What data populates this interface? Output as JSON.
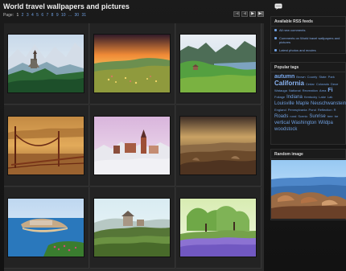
{
  "header": {
    "title": "World travel wallpapers and pictures"
  },
  "pager": {
    "label": "Page:",
    "pages": [
      "1",
      "2",
      "3",
      "4",
      "5",
      "6",
      "7",
      "8",
      "9",
      "10",
      "...",
      "30",
      "31"
    ]
  },
  "sidebar": {
    "rss_title": "Available RSS feeds",
    "rss_items": [
      "All new comments",
      "Comments on World travel wallpapers and pictures",
      "Latest photos and movies"
    ],
    "tags_title": "Popular tags",
    "tags_lines": [
      [
        {
          "text": "autumn",
          "size": "lg"
        },
        {
          "text": "Brown",
          "size": "sm"
        },
        {
          "text": "County",
          "size": "sm"
        },
        {
          "text": "State",
          "size": "sm"
        },
        {
          "text": "Park",
          "size": "sm"
        }
      ],
      [
        {
          "text": "California",
          "size": "xl"
        },
        {
          "text": "Cedar",
          "size": "sm"
        },
        {
          "text": "Colorado",
          "size": "sm"
        },
        {
          "text": "Dece",
          "size": "sm"
        }
      ],
      [
        {
          "text": "Watauga",
          "size": "sm"
        },
        {
          "text": "National",
          "size": "sm"
        },
        {
          "text": "Recreation",
          "size": "sm"
        },
        {
          "text": "Area",
          "size": "sm"
        },
        {
          "text": "Fi",
          "size": "lg"
        }
      ],
      [
        {
          "text": "Foliage",
          "size": "sm"
        },
        {
          "text": "Indiana",
          "size": "md"
        },
        {
          "text": "Kentucky",
          "size": "sm"
        },
        {
          "text": "Lake",
          "size": "sm"
        },
        {
          "text": "Lak",
          "size": "sm"
        }
      ],
      [
        {
          "text": "Louisville",
          "size": "md"
        },
        {
          "text": "Maple",
          "size": "md"
        },
        {
          "text": "Neuschwanstein",
          "size": "md"
        }
      ],
      [
        {
          "text": "England",
          "size": "sm"
        },
        {
          "text": "Pennsylvania",
          "size": "sm"
        },
        {
          "text": "Pond",
          "size": "sm"
        },
        {
          "text": "Reflection",
          "size": "sm"
        },
        {
          "text": "R",
          "size": "sm"
        }
      ],
      [
        {
          "text": "Roads",
          "size": "md"
        },
        {
          "text": "rural",
          "size": "sm"
        },
        {
          "text": "Scenic",
          "size": "sm"
        },
        {
          "text": "Sunrise",
          "size": "md"
        },
        {
          "text": "tree",
          "size": "sm"
        },
        {
          "text": "tre",
          "size": "sm"
        }
      ],
      [
        {
          "text": "vertical",
          "size": "md"
        },
        {
          "text": "Washington",
          "size": "md"
        },
        {
          "text": "Wildpa",
          "size": "md"
        }
      ],
      [
        {
          "text": "woodstock",
          "size": "md"
        }
      ]
    ],
    "random_title": "Random image"
  },
  "gallery": {
    "thumbnails": [
      "castle-lake-mountains",
      "sunset-meadow",
      "green-valley-lake",
      "golden-gate-bridge",
      "winter-town-church",
      "rocky-desert-dusk",
      "island-coast",
      "hilltop-castle-vineyard",
      "lavender-field-trees"
    ]
  }
}
